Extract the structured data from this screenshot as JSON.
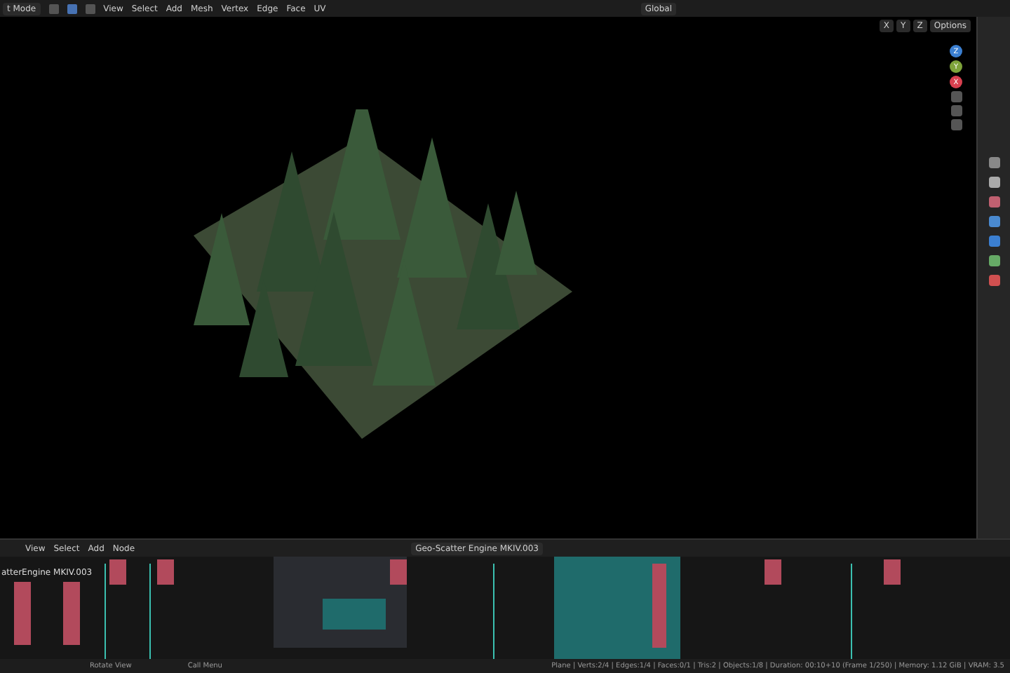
{
  "header": {
    "mode": "t Mode",
    "select_modes": [
      {
        "selected": false
      },
      {
        "selected": true
      },
      {
        "selected": false
      }
    ],
    "menus": [
      "View",
      "Select",
      "Add",
      "Mesh",
      "Vertex",
      "Edge",
      "Face",
      "UV"
    ],
    "transform": "Global",
    "axes": [
      "X",
      "Y",
      "Z"
    ],
    "options": "Options"
  },
  "viewport": {
    "gizmo": [
      {
        "label": "Z",
        "color": "#3b7fd1"
      },
      {
        "label": "Y",
        "color": "#7ea33a"
      },
      {
        "label": "X",
        "color": "#d8404f"
      }
    ]
  },
  "node_editor": {
    "menus": [
      "View",
      "Select",
      "Add",
      "Node"
    ],
    "tree_name": "Geo-Scatter Engine MKIV.003",
    "frame_label": "atterEngine MKIV.003"
  },
  "status_bar": {
    "hints": [
      "Rotate View",
      "Call Menu"
    ],
    "stats": "Plane | Verts:2/4 | Edges:1/4 | Faces:0/1 | Tris:2 | Objects:1/8 | Duration: 00:10+10 (Frame 1/250) | Memory: 1.12 GiB | VRAM: 3.5"
  }
}
